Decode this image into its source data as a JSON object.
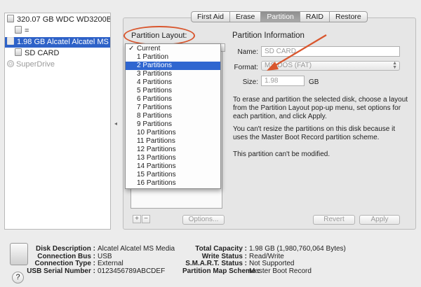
{
  "sidebar": {
    "items": [
      {
        "label": "320.07 GB WDC WD3200BPVT",
        "selected": false,
        "disabled": false
      },
      {
        "label": "=",
        "selected": false,
        "disabled": false
      },
      {
        "label": "1.98 GB Alcatel Alcatel MS Media",
        "selected": true,
        "disabled": false
      },
      {
        "label": "SD CARD",
        "selected": false,
        "disabled": false
      },
      {
        "label": "SuperDrive",
        "selected": false,
        "disabled": true
      }
    ]
  },
  "tabs": [
    {
      "label": "First Aid",
      "active": false
    },
    {
      "label": "Erase",
      "active": false
    },
    {
      "label": "Partition",
      "active": true
    },
    {
      "label": "RAID",
      "active": false
    },
    {
      "label": "Restore",
      "active": false
    }
  ],
  "partition": {
    "layout_label": "Partition Layout:",
    "layout_options": [
      "Current",
      "1 Partition",
      "2 Partitions",
      "3 Partitions",
      "4 Partitions",
      "5 Partitions",
      "6 Partitions",
      "7 Partitions",
      "8 Partitions",
      "9 Partitions",
      "10 Partitions",
      "11 Partitions",
      "12 Partitions",
      "13 Partitions",
      "14 Partitions",
      "15 Partitions",
      "16 Partitions"
    ],
    "checked_option": "Current",
    "highlighted_option": "2 Partitions",
    "add_label": "+",
    "remove_label": "−",
    "options_button": "Options..."
  },
  "info": {
    "title": "Partition Information",
    "name_label": "Name:",
    "name_value": "SD CARD",
    "format_label": "Format:",
    "format_value": "MS-DOS (FAT)",
    "size_label": "Size:",
    "size_value": "1.98",
    "size_unit": "GB",
    "desc1": "To erase and partition the selected disk, choose a layout from the Partition Layout pop-up menu, set options for each partition, and click Apply.",
    "desc2": "You can't resize the partitions on this disk because it uses the Master Boot Record partition scheme.",
    "desc3": "This partition can't be modified.",
    "revert_button": "Revert",
    "apply_button": "Apply"
  },
  "details": {
    "left": [
      {
        "key": "Disk Description :",
        "value": "Alcatel Alcatel MS Media"
      },
      {
        "key": "Connection Bus :",
        "value": "USB"
      },
      {
        "key": "Connection Type :",
        "value": "External"
      },
      {
        "key": "USB Serial Number :",
        "value": "0123456789ABCDEF"
      }
    ],
    "right": [
      {
        "key": "Total Capacity :",
        "value": "1.98 GB (1,980,760,064 Bytes)"
      },
      {
        "key": "Write Status :",
        "value": "Read/Write"
      },
      {
        "key": "S.M.A.R.T. Status :",
        "value": "Not Supported"
      },
      {
        "key": "Partition Map Scheme :",
        "value": "Master Boot Record"
      }
    ],
    "help_label": "?"
  },
  "colors": {
    "selection": "#2e62c8",
    "annotation": "#d9562d"
  }
}
